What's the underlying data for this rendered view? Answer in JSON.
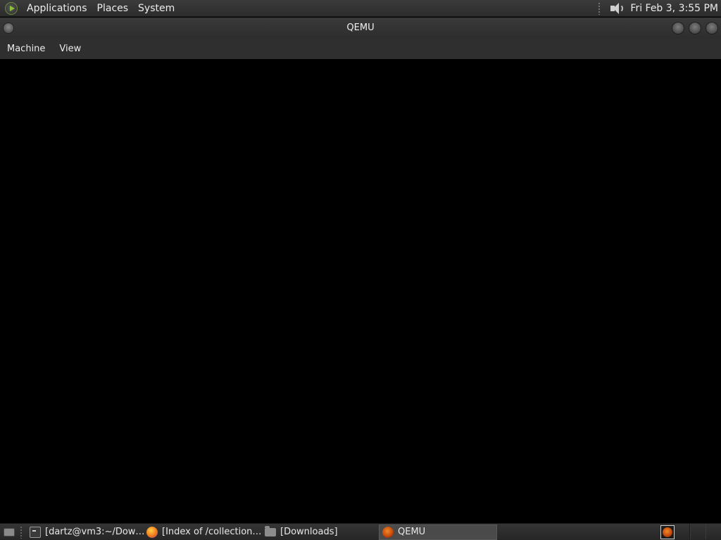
{
  "top_panel": {
    "menus": [
      "Applications",
      "Places",
      "System"
    ],
    "clock": "Fri Feb  3,  3:55 PM"
  },
  "window": {
    "title": "QEMU",
    "menubar": [
      "Machine",
      "View"
    ]
  },
  "taskbar": {
    "tasks": [
      {
        "label": "[dartz@vm3:~/Dow…",
        "icon": "terminal-icon",
        "active": false
      },
      {
        "label": "[Index of /collection…",
        "icon": "firefox-icon",
        "active": false
      },
      {
        "label": "[Downloads]",
        "icon": "folder-icon",
        "active": false
      },
      {
        "label": "QEMU",
        "icon": "qemu-icon",
        "active": true
      }
    ]
  }
}
